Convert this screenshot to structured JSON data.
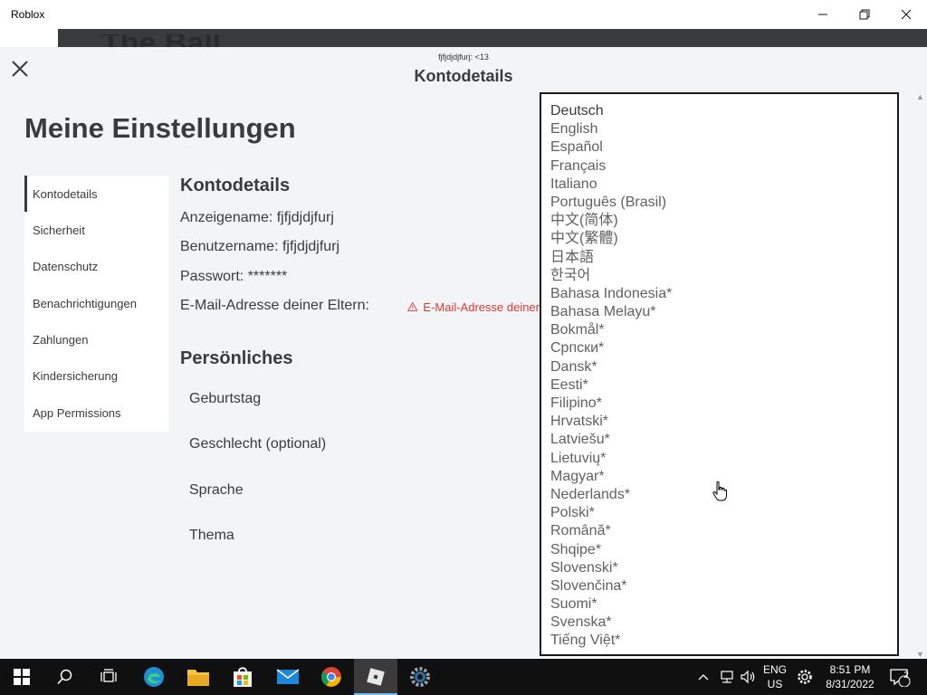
{
  "window": {
    "title": "Roblox",
    "ghost_text": "The Ball"
  },
  "modal": {
    "sub_label": "fjfjdjdjfurj: <13",
    "title": "Kontodetails"
  },
  "page": {
    "heading": "Meine Einstellungen"
  },
  "sidebar": {
    "items": [
      {
        "label": "Kontodetails",
        "active": true
      },
      {
        "label": "Sicherheit"
      },
      {
        "label": "Datenschutz"
      },
      {
        "label": "Benachrichtigungen"
      },
      {
        "label": "Zahlungen"
      },
      {
        "label": "Kindersicherung"
      },
      {
        "label": "App Permissions"
      }
    ]
  },
  "account": {
    "section_title": "Kontodetails",
    "display_name": "Anzeigename: fjfjdjdjfurj",
    "username": "Benutzername: fjfjdjdjfurj",
    "password": "Passwort: *******",
    "parent_email_label": "E-Mail-Adresse deiner Eltern:",
    "parent_email_warning": "E-Mail-Adresse deiner"
  },
  "personal": {
    "section_title": "Persönliches",
    "items": [
      "Geburtstag",
      "Geschlecht (optional)",
      "Sprache",
      "Thema"
    ]
  },
  "language_dropdown": {
    "selected": "Deutsch",
    "options": [
      "Deutsch",
      "English",
      "Español",
      "Français",
      "Italiano",
      "Português (Brasil)",
      "中文(简体)",
      "中文(繁體)",
      "日本語",
      "한국어",
      "Bahasa Indonesia*",
      "Bahasa Melayu*",
      "Bokmål*",
      "Српски*",
      "Dansk*",
      "Eesti*",
      "Filipino*",
      "Hrvatski*",
      "Latviešu*",
      "Lietuvių*",
      "Magyar*",
      "Nederlands*",
      "Polski*",
      "Română*",
      "Shqipe*",
      "Slovenski*",
      "Slovenčina*",
      "Suomi*",
      "Svenska*",
      "Tiếng Việt*"
    ]
  },
  "taskbar": {
    "language": "ENG",
    "region": "US",
    "time": "8:51 PM",
    "date": "8/31/2022",
    "notification_count": "2"
  },
  "colors": {
    "text_dark": "#393b3d",
    "warning": "#d8393a",
    "taskbar": "#101010",
    "accent": "#76b9ed"
  }
}
